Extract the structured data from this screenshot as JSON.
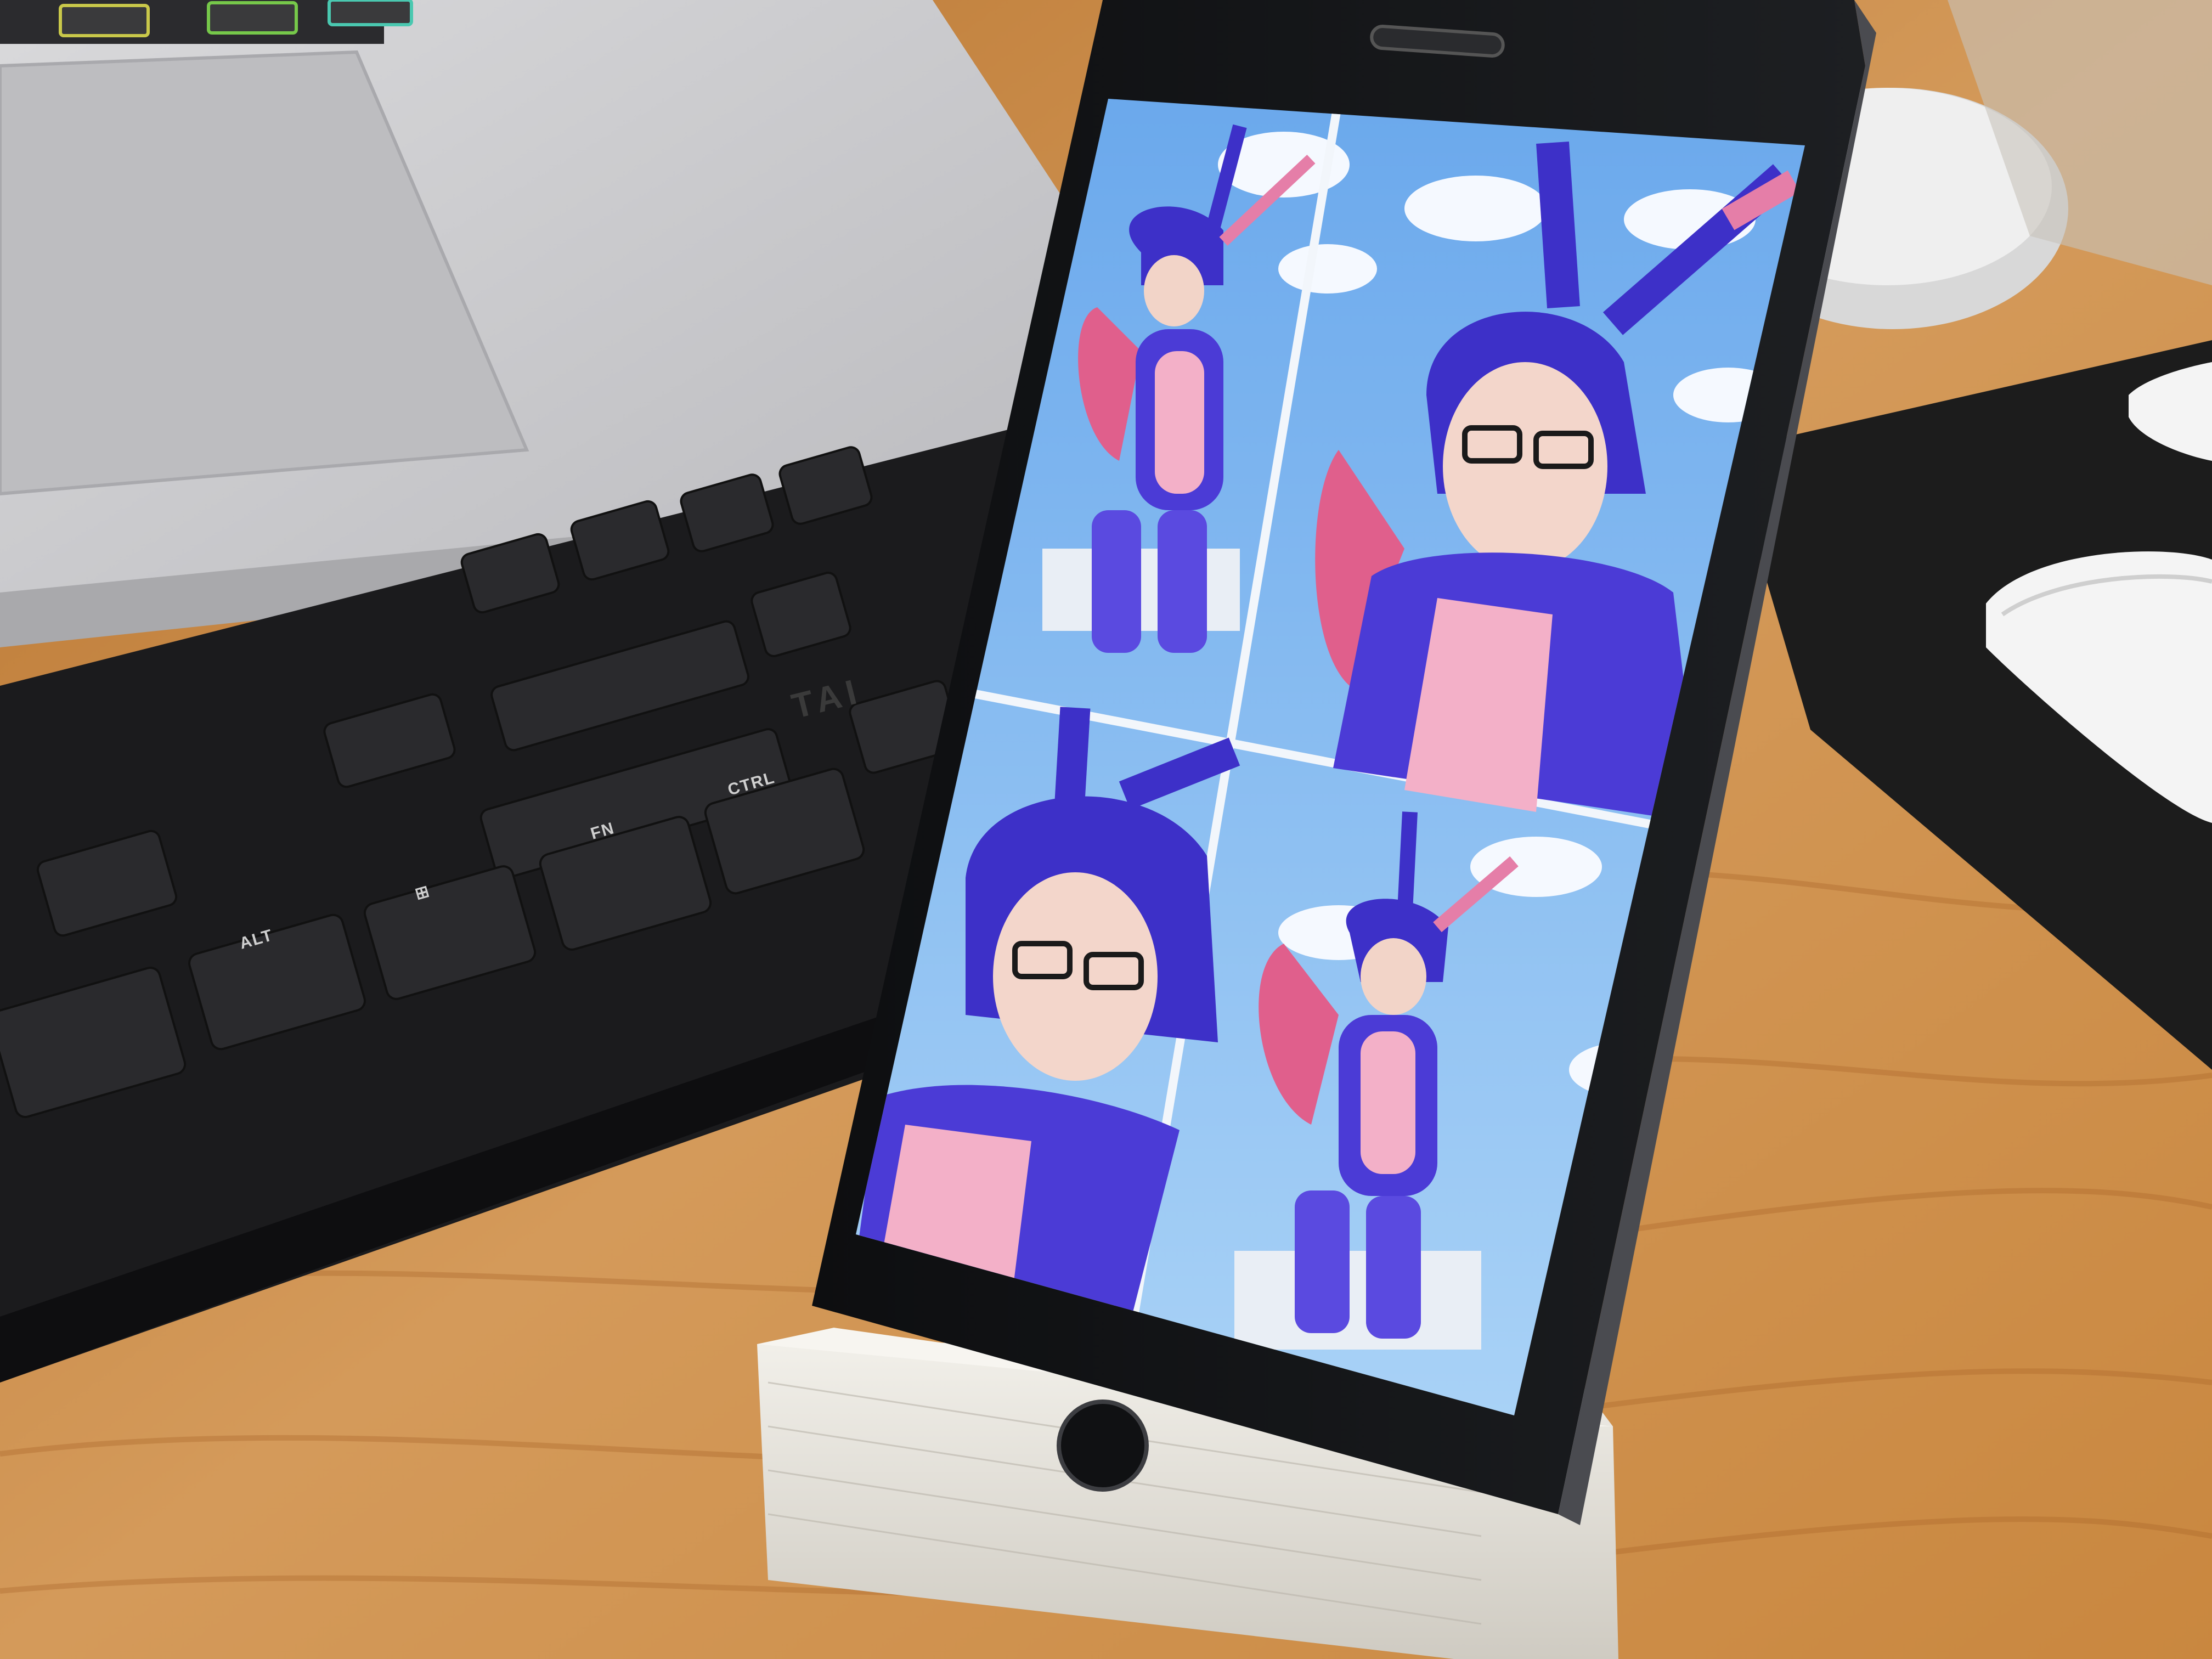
{
  "scene": {
    "description_free": true,
    "keycaps": {
      "alt": "ALT",
      "fn": "FN",
      "ctrl": "CTRL",
      "win": "⊞"
    },
    "keyboard_brand_partial": "TAI",
    "phone": {
      "screen_tiles": [
        {
          "name": "tile-top-left",
          "framing": "full-body"
        },
        {
          "name": "tile-top-right",
          "framing": "close-up"
        },
        {
          "name": "tile-bottom-left",
          "framing": "close-up"
        },
        {
          "name": "tile-bottom-right",
          "framing": "full-body"
        }
      ]
    },
    "colors": {
      "desk_wood": "#c98a4a",
      "laptop_silver": "#cfcfd1",
      "keyboard_black": "#1b1b1d",
      "mousepad": "#1c1c1c",
      "phone_body": "#111214",
      "costume_purple": "#4b3bd6",
      "costume_pink": "#f07aa8",
      "sky_blue": "#7ab6ef",
      "stand_white": "#e9e6df"
    }
  }
}
